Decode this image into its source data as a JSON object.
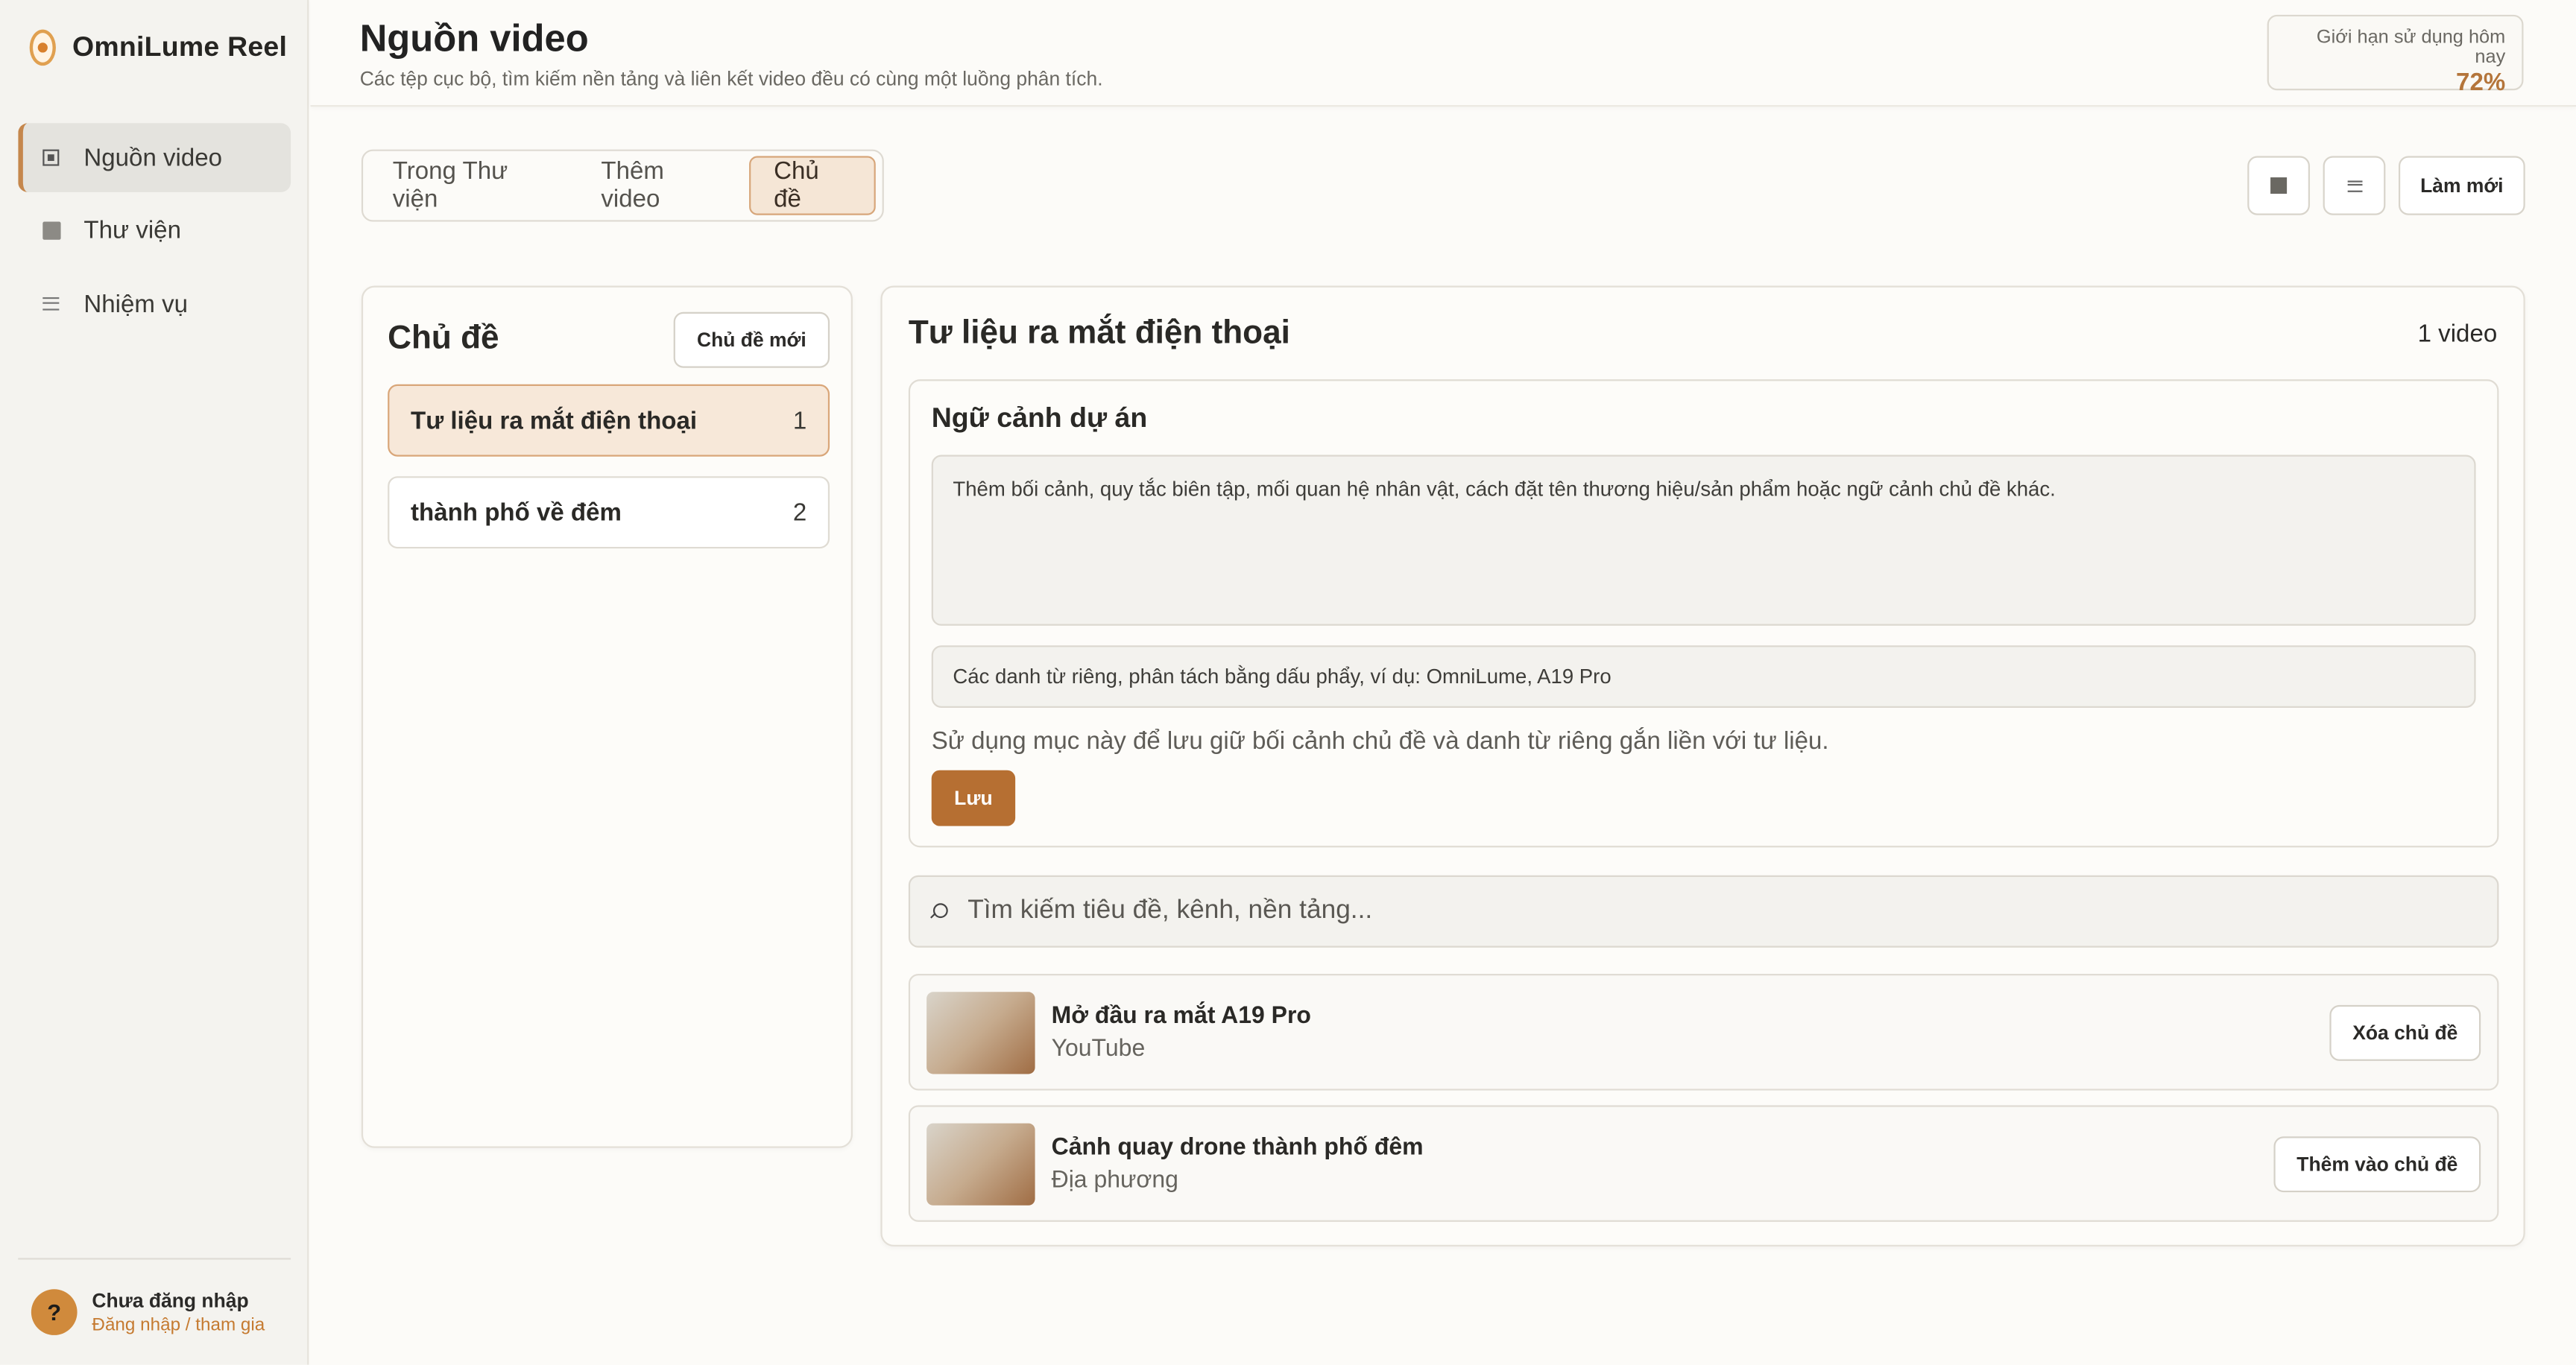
{
  "app": {
    "name": "OmniLume Reel"
  },
  "sidebar": {
    "items": [
      {
        "label": "Nguồn video",
        "icon": "source-icon",
        "active": true
      },
      {
        "label": "Thư viện",
        "icon": "library-icon",
        "active": false
      },
      {
        "label": "Nhiệm vụ",
        "icon": "tasks-icon",
        "active": false
      }
    ],
    "account": {
      "avatar_glyph": "?",
      "title": "Chưa đăng nhập",
      "subtitle": "Đăng nhập / tham gia"
    }
  },
  "header": {
    "title": "Nguồn video",
    "subtitle": "Các tệp cục bộ, tìm kiếm nền tảng và liên kết video đều có cùng một luồng phân tích.",
    "usage_label": "Giới hạn sử dụng hôm nay",
    "usage_value": "72%"
  },
  "tabs": [
    {
      "label": "Trong Thư viện",
      "active": false
    },
    {
      "label": "Thêm video",
      "active": false
    },
    {
      "label": "Chủ đề",
      "active": true
    }
  ],
  "toolbar": {
    "stop_icon": "stop-icon",
    "list_icon": "list-icon",
    "refresh_label": "Làm mới"
  },
  "topics": {
    "title": "Chủ đề",
    "new_label": "Chủ đề mới",
    "items": [
      {
        "name": "Tư liệu ra mắt điện thoại",
        "count": "1",
        "active": true
      },
      {
        "name": "thành phố về đêm",
        "count": "2",
        "active": false
      }
    ]
  },
  "detail": {
    "title": "Tư liệu ra mắt điện thoại",
    "count": "1 video",
    "context": {
      "title": "Ngữ cảnh dự án",
      "textarea_placeholder": "Thêm bối cảnh, quy tắc biên tập, mối quan hệ nhân vật, cách đặt tên thương hiệu/sản phẩm hoặc ngữ cảnh chủ đề khác.",
      "nouns_placeholder": "Các danh từ riêng, phân tách bằng dấu phẩy, ví dụ: OmniLume, A19 Pro",
      "hint": "Sử dụng mục này để lưu giữ bối cảnh chủ đề và danh từ riêng gắn liền với tư liệu.",
      "save_label": "Lưu"
    },
    "search_placeholder": "Tìm kiếm tiêu đề, kênh, nền tảng...",
    "videos": [
      {
        "title": "Mở đầu ra mắt A19 Pro",
        "source": "YouTube",
        "action": "Xóa chủ đề"
      },
      {
        "title": "Cảnh quay drone thành phố đêm",
        "source": "Địa phương",
        "action": "Thêm vào chủ đề"
      }
    ]
  },
  "colors": {
    "accent": "#b66f32",
    "usage_value": "#b4753a",
    "active_tab_bg": "#f5e6d6"
  }
}
